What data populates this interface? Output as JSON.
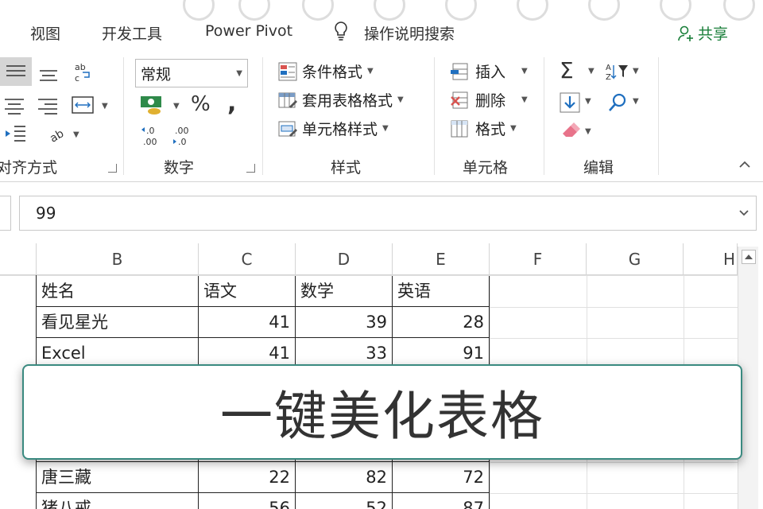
{
  "ribbon_tabs": {
    "view": "视图",
    "developer": "开发工具",
    "power_pivot": "Power Pivot",
    "tell_me": "操作说明搜索",
    "share": "共享"
  },
  "ribbon": {
    "alignment": {
      "label": "对齐方式"
    },
    "number": {
      "label": "数字",
      "format_value": "常规",
      "percent": "%",
      "comma": ","
    },
    "styles": {
      "label": "样式",
      "conditional_formatting": "条件格式",
      "format_as_table": "套用表格格式",
      "cell_styles": "单元格样式"
    },
    "cells": {
      "label": "单元格",
      "insert": "插入",
      "delete": "删除",
      "format": "格式"
    },
    "editing": {
      "label": "编辑"
    }
  },
  "formula_bar": {
    "value": "99"
  },
  "sheet": {
    "columns": [
      "B",
      "C",
      "D",
      "E",
      "F",
      "G",
      "H"
    ],
    "header": [
      "姓名",
      "语文",
      "数学",
      "英语"
    ],
    "rows": [
      [
        "看见星光",
        "41",
        "39",
        "28"
      ],
      [
        "Excel",
        "41",
        "33",
        "91"
      ],
      [
        "唐三藏",
        "22",
        "82",
        "72"
      ],
      [
        "猪八戒",
        "56",
        "52",
        "87"
      ]
    ]
  },
  "banner": {
    "text": "一键美化表格"
  },
  "colors": {
    "accent_green": "#1a7f3a",
    "banner_border": "#3a8a80"
  }
}
